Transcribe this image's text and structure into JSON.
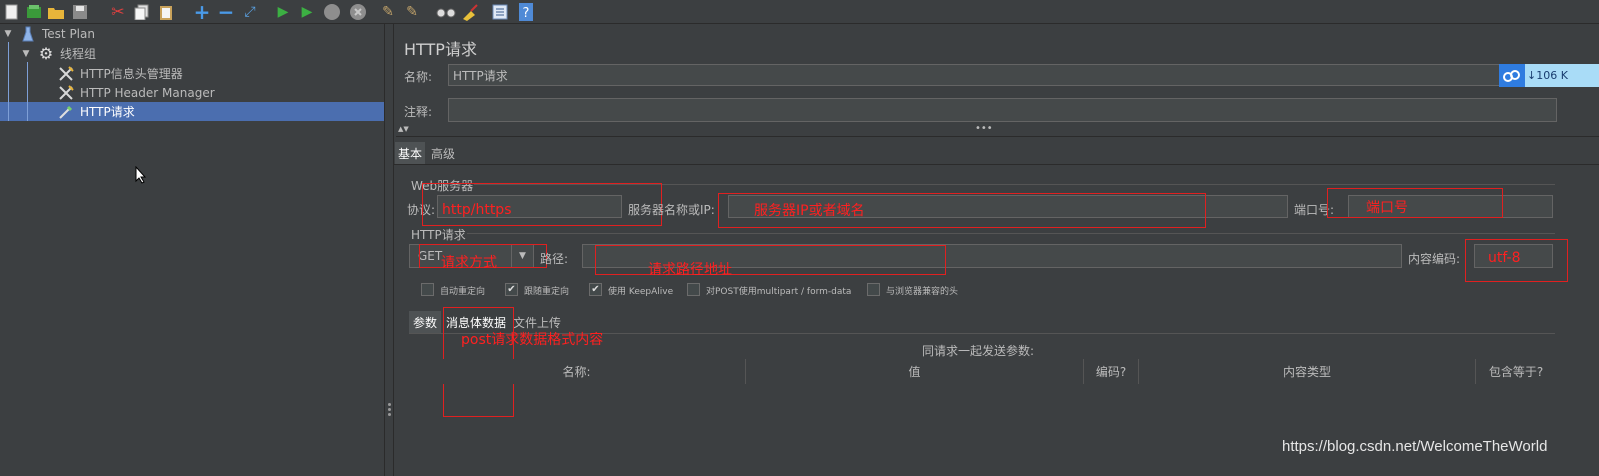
{
  "toolbar": {
    "icons": [
      "new-icon",
      "templates-icon",
      "open-icon",
      "save-icon",
      "cut-icon",
      "copy-icon",
      "paste-icon",
      "expand-icon",
      "collapse-icon",
      "toggle-icon",
      "start-icon",
      "start-no-pause-icon",
      "stop-icon",
      "shutdown-icon",
      "clear-icon",
      "clear-all-icon",
      "search-icon",
      "reset-search-icon",
      "function-helper-icon",
      "help-icon"
    ]
  },
  "tree": {
    "items": [
      {
        "label": "Test Plan",
        "icon": "test-plan-icon"
      },
      {
        "label": "线程组",
        "icon": "thread-group-gear-icon"
      },
      {
        "label": "HTTP信息头管理器",
        "icon": "config-wrench-icon"
      },
      {
        "label": "HTTP Header Manager",
        "icon": "config-wrench-icon"
      },
      {
        "label": "HTTP请求",
        "icon": "sampler-pipette-icon"
      }
    ]
  },
  "panel": {
    "title": "HTTP请求",
    "name_label": "名称:",
    "name_value": "HTTP请求",
    "comment_label": "注释:",
    "comment_value": "",
    "tabs": [
      "基本",
      "高级"
    ],
    "web_server_label": "Web服务器",
    "protocol_label": "协议:",
    "protocol_annotation": "http/https",
    "server_label": "服务器名称或IP:",
    "server_annotation": "服务器IP或者域名",
    "port_label": "端口号:",
    "port_annotation": "端口号",
    "http_request_label": "HTTP请求",
    "method_value": "GET",
    "method_annotation": "请求方式",
    "path_label": "路径:",
    "path_annotation": "请求路径地址",
    "encoding_label": "内容编码:",
    "encoding_annotation": "utf-8",
    "checkboxes": [
      {
        "label": "自动重定向",
        "checked": false
      },
      {
        "label": "跟随重定向",
        "checked": true
      },
      {
        "label": "使用 KeepAlive",
        "checked": true
      },
      {
        "label": "对POST使用multipart / form-data",
        "checked": false
      },
      {
        "label": "与浏览器兼容的头",
        "checked": false
      }
    ],
    "sub_tabs": [
      "参数",
      "消息体数据",
      "文件上传"
    ],
    "body_annotation": "post请求数据格式内容",
    "send_params_label": "同请求一起发送参数:",
    "table_headers": [
      "名称:",
      "值",
      "编码?",
      "内容类型",
      "包含等于?"
    ]
  },
  "overlay": {
    "badge_text": "106 K",
    "watermark": "https://blog.csdn.net/WelcomeTheWorld"
  },
  "colors": {
    "background": "#3c3f41",
    "selection": "#4b6eaf",
    "annotation_red": "#e02020",
    "field_bg": "#45494a"
  }
}
